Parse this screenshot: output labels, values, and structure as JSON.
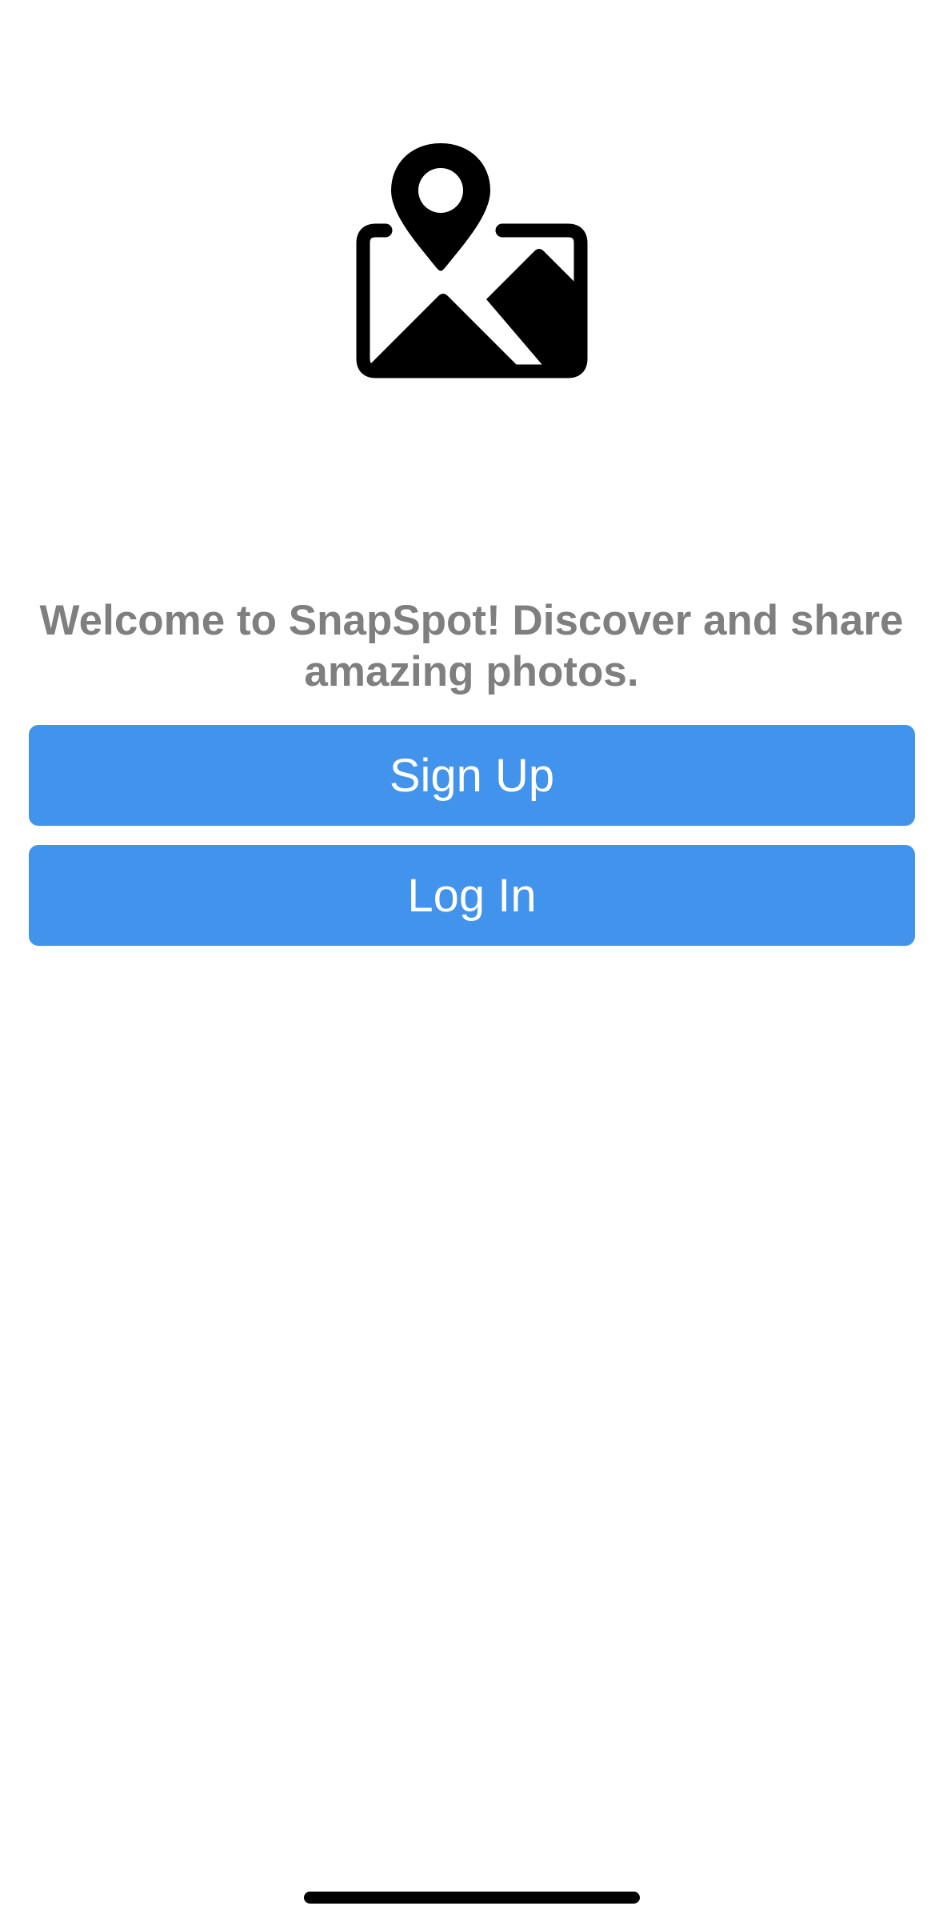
{
  "app": {
    "logo_icon": "map-pin-photo-icon"
  },
  "welcome": {
    "text": "Welcome to SnapSpot! Discover and share amazing photos."
  },
  "buttons": {
    "signup_label": "Sign Up",
    "login_label": "Log In"
  },
  "colors": {
    "button_background": "#4293ec",
    "button_text": "#ffffff",
    "welcome_text": "#7f7f7f",
    "background": "#ffffff"
  }
}
